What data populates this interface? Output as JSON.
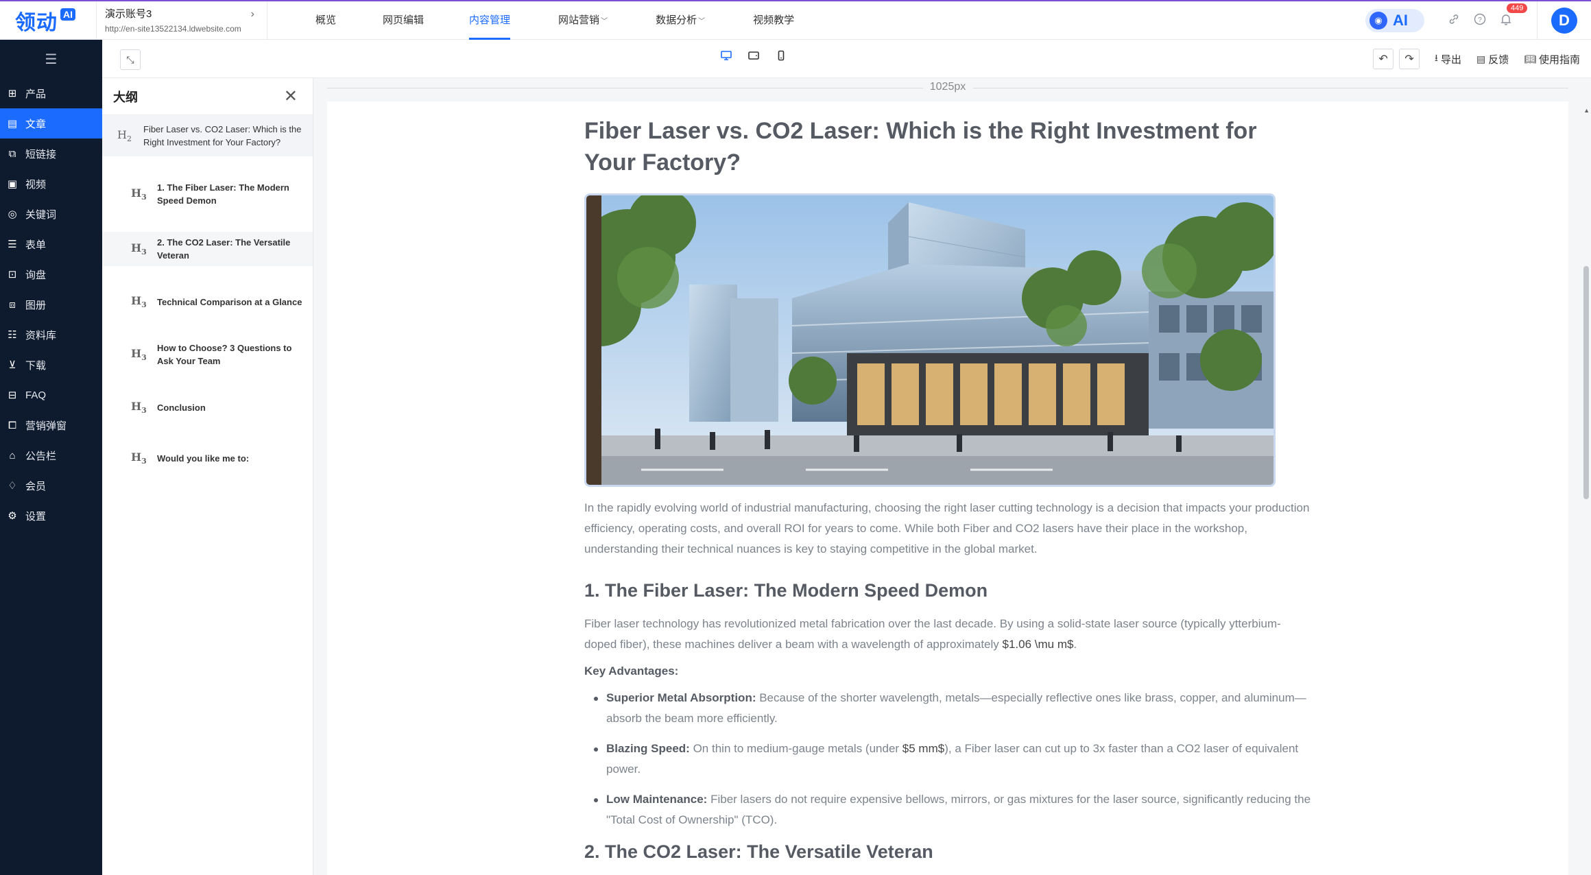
{
  "topbar": {
    "logo": "领动",
    "logo_badge": "AI",
    "account_name": "演示账号3",
    "account_url": "http://en-site13522134.ldwebsite.com",
    "nav": [
      {
        "label": "概览",
        "caret": ""
      },
      {
        "label": "网页编辑",
        "caret": ""
      },
      {
        "label": "内容管理",
        "caret": ""
      },
      {
        "label": "网站营销",
        "caret": "﹀"
      },
      {
        "label": "数据分析",
        "caret": "﹀"
      },
      {
        "label": "视频教学",
        "caret": ""
      }
    ],
    "active_nav": "内容管理",
    "ai_label": "AI",
    "notification_count": "449",
    "avatar": "D",
    "accent_color": "#1b6bff"
  },
  "sidebar": {
    "items": [
      {
        "label": "产品",
        "icon": "grid-icon"
      },
      {
        "label": "文章",
        "icon": "document-icon"
      },
      {
        "label": "短链接",
        "icon": "link-icon"
      },
      {
        "label": "视频",
        "icon": "video-icon"
      },
      {
        "label": "关键词",
        "icon": "target-icon"
      },
      {
        "label": "表单",
        "icon": "form-icon"
      },
      {
        "label": "询盘",
        "icon": "chat-icon"
      },
      {
        "label": "图册",
        "icon": "album-icon"
      },
      {
        "label": "资料库",
        "icon": "database-icon"
      },
      {
        "label": "下载",
        "icon": "download-icon"
      },
      {
        "label": "FAQ",
        "icon": "faq-icon"
      },
      {
        "label": "营销弹窗",
        "icon": "popup-icon"
      },
      {
        "label": "公告栏",
        "icon": "bulletin-icon"
      },
      {
        "label": "会员",
        "icon": "member-icon"
      },
      {
        "label": "设置",
        "icon": "settings-icon"
      }
    ],
    "active": "文章"
  },
  "toolbar": {
    "devices": [
      "desktop",
      "tablet",
      "mobile"
    ],
    "active_device": "desktop",
    "export_label": "导出",
    "feedback_label": "反馈",
    "guide_label": "使用指南"
  },
  "outline": {
    "title": "大纲",
    "items": [
      {
        "level": "H2",
        "text": "Fiber Laser vs. CO2 Laser: Which is the Right Investment for Your Factory?"
      },
      {
        "level": "H3",
        "text": "1. The Fiber Laser: The Modern Speed Demon"
      },
      {
        "level": "H3",
        "text": "2. The CO2 Laser: The Versatile Veteran"
      },
      {
        "level": "H3",
        "text": "Technical Comparison at a Glance"
      },
      {
        "level": "H3",
        "text": "How to Choose? 3 Questions to Ask Your Team"
      },
      {
        "level": "H3",
        "text": "Conclusion"
      },
      {
        "level": "H3",
        "text": "Would you like me to:"
      }
    ]
  },
  "canvas": {
    "ruler_label": "1025px"
  },
  "article": {
    "title": "Fiber Laser vs. CO2 Laser: Which is the Right Investment for Your Factory?",
    "intro": "In the rapidly evolving world of industrial manufacturing, choosing the right laser cutting technology is a decision that impacts your production efficiency, operating costs, and overall ROI for years to come. While both Fiber and CO2 lasers have their place in the workshop, understanding their technical nuances is key to staying competitive in the global market.",
    "section1_heading": "1. The Fiber Laser: The Modern Speed Demon",
    "section1_para_a": "Fiber laser technology has revolutionized metal fabrication over the last decade. By using a solid-state laser source (typically ytterbium-doped fiber), these machines deliver a beam with a wavelength of approximately ",
    "section1_para_b": "$1.06 \\mu m$",
    "section1_para_c": ".",
    "key_label": "Key Advantages:",
    "bullets": [
      {
        "bold": "Superior Metal Absorption:",
        "text_a": " Because of the shorter wavelength, metals—especially reflective ones like brass, copper, and aluminum—absorb the beam more efficiently.",
        "dark": "",
        "text_b": ""
      },
      {
        "bold": "Blazing Speed:",
        "text_a": " On thin to medium-gauge metals (under ",
        "dark": "$5 mm$",
        "text_b": "), a Fiber laser can cut up to 3x faster than a CO2 laser of equivalent power."
      },
      {
        "bold": "Low Maintenance:",
        "text_a": " Fiber lasers do not require expensive bellows, mirrors, or gas mixtures for the laser source, significantly reducing the \"Total Cost of Ownership\" (TCO).",
        "dark": "",
        "text_b": ""
      }
    ],
    "section2_heading": "2. The CO2 Laser: The Versatile Veteran"
  }
}
